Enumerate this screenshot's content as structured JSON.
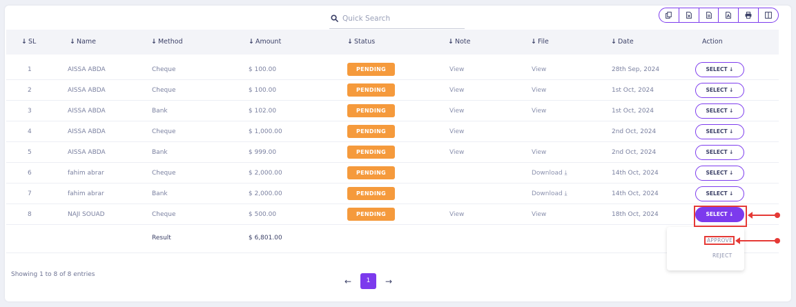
{
  "search": {
    "placeholder": "Quick Search"
  },
  "toolbar": {
    "buttons": [
      "copy-icon",
      "csv-icon",
      "excel-icon",
      "pdf-icon",
      "print-icon",
      "columns-icon"
    ]
  },
  "table": {
    "headers": {
      "sl": "SL",
      "name": "Name",
      "method": "Method",
      "amount": "Amount",
      "status": "Status",
      "note": "Note",
      "file": "File",
      "date": "Date",
      "action": "Action"
    },
    "sort_arrow": "↓",
    "rows": [
      {
        "sl": "1",
        "name": "AISSA ABDA",
        "method": "Cheque",
        "amount": "$ 100.00",
        "status": "PENDING",
        "note": "View",
        "file": "View",
        "date": "28th Sep, 2024",
        "action": "SELECT ↓"
      },
      {
        "sl": "2",
        "name": "AISSA ABDA",
        "method": "Cheque",
        "amount": "$ 100.00",
        "status": "PENDING",
        "note": "View",
        "file": "View",
        "date": "1st Oct, 2024",
        "action": "SELECT ↓"
      },
      {
        "sl": "3",
        "name": "AISSA ABDA",
        "method": "Bank",
        "amount": "$ 102.00",
        "status": "PENDING",
        "note": "View",
        "file": "View",
        "date": "1st Oct, 2024",
        "action": "SELECT ↓"
      },
      {
        "sl": "4",
        "name": "AISSA ABDA",
        "method": "Cheque",
        "amount": "$ 1,000.00",
        "status": "PENDING",
        "note": "View",
        "file": "",
        "date": "2nd Oct, 2024",
        "action": "SELECT ↓"
      },
      {
        "sl": "5",
        "name": "AISSA ABDA",
        "method": "Bank",
        "amount": "$ 999.00",
        "status": "PENDING",
        "note": "View",
        "file": "View",
        "date": "2nd Oct, 2024",
        "action": "SELECT ↓"
      },
      {
        "sl": "6",
        "name": "fahim abrar",
        "method": "Cheque",
        "amount": "$ 2,000.00",
        "status": "PENDING",
        "note": "",
        "file": "Download ⤓",
        "date": "14th Oct, 2024",
        "action": "SELECT ↓"
      },
      {
        "sl": "7",
        "name": "fahim abrar",
        "method": "Bank",
        "amount": "$ 2,000.00",
        "status": "PENDING",
        "note": "",
        "file": "Download ⤓",
        "date": "14th Oct, 2024",
        "action": "SELECT ↓"
      },
      {
        "sl": "8",
        "name": "NAJI SOUAD",
        "method": "Cheque",
        "amount": "$ 500.00",
        "status": "PENDING",
        "note": "View",
        "file": "View",
        "date": "18th Oct, 2024",
        "action": "SELECT ↓"
      }
    ],
    "result": {
      "label": "Result",
      "total": "$ 6,801.00"
    }
  },
  "dropdown": {
    "approve": "APPROVE",
    "reject": "REJECT"
  },
  "footer": {
    "showing": "Showing 1 to 8 of 8 entries",
    "prev": "←",
    "page": "1",
    "next": "→"
  },
  "colors": {
    "accent": "#7c3aed",
    "pending": "#f59a3c",
    "annotation": "#e53935"
  }
}
